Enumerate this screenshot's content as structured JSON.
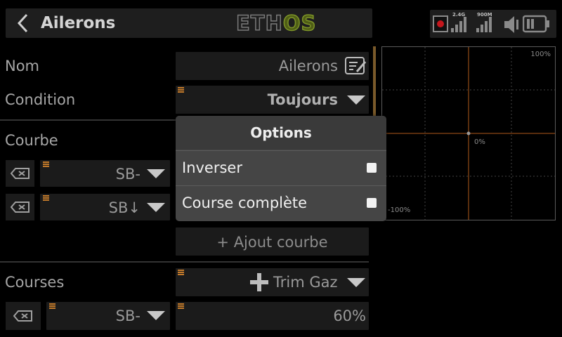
{
  "header": {
    "title": "Ailerons",
    "logo_left": "ETH",
    "logo_right": "OS",
    "signal_2g4": "2.4G",
    "signal_900m": "900M"
  },
  "form": {
    "name_label": "Nom",
    "name_value": "Ailerons",
    "condition_label": "Condition",
    "condition_value": "Toujours",
    "curve_label": "Courbe",
    "curve_rows": [
      {
        "source": "SB-"
      },
      {
        "source": "SB↓"
      }
    ],
    "add_curve_label": "+ Ajout courbe",
    "courses_label": "Courses",
    "courses_source": "Trim Gaz",
    "courses_switch": "SB-",
    "courses_value": "60%"
  },
  "chart": {
    "top_label": "100%",
    "center_label": "0%",
    "bottom_label": "-100%"
  },
  "dialog": {
    "title": "Options",
    "options": [
      {
        "label": "Inverser",
        "checked": false
      },
      {
        "label": "Course complète",
        "checked": false
      }
    ]
  }
}
